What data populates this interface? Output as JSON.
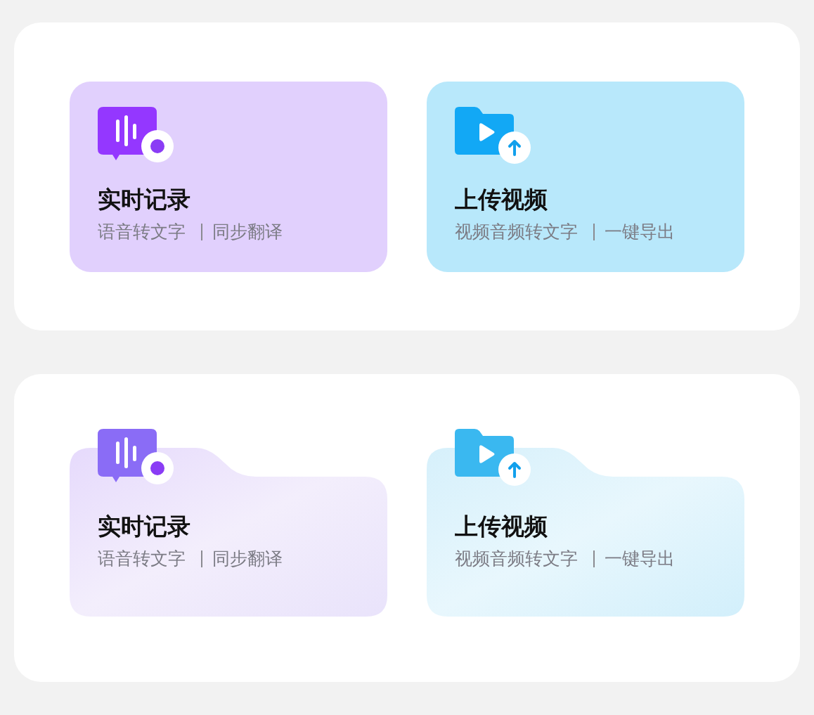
{
  "panels": [
    {
      "kind": "flat",
      "cards": [
        {
          "kind": "voice",
          "title": "实时记录",
          "features": [
            "语音转文字",
            "同步翻译"
          ]
        },
        {
          "kind": "video",
          "title": "上传视频",
          "features": [
            "视频音频转文字",
            "一键导出"
          ]
        }
      ]
    },
    {
      "kind": "folder",
      "cards": [
        {
          "kind": "voice",
          "title": "实时记录",
          "features": [
            "语音转文字",
            "同步翻译"
          ]
        },
        {
          "kind": "video",
          "title": "上传视频",
          "features": [
            "视频音频转文字",
            "一键导出"
          ]
        }
      ]
    }
  ]
}
